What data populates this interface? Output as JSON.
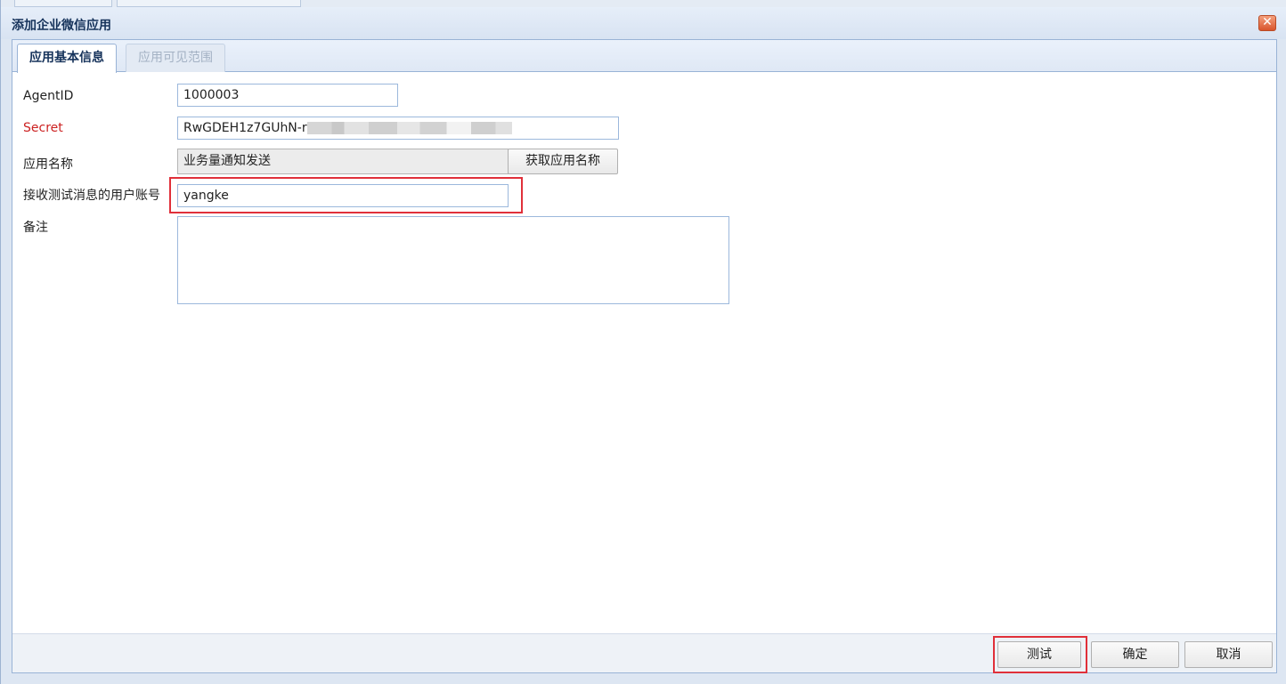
{
  "window": {
    "title": "添加企业微信应用",
    "close_glyph": "✕"
  },
  "tabs": [
    {
      "label": "应用基本信息",
      "active": true
    },
    {
      "label": "应用可见范围",
      "active": false
    }
  ],
  "form": {
    "agentid": {
      "label": "AgentID",
      "value": "1000003"
    },
    "secret": {
      "label": "Secret",
      "value_visible": "RwGDEH1z7GUhN-r",
      "label_color": "#cc2222"
    },
    "app_name": {
      "label": "应用名称",
      "value": "业务量通知发送",
      "button": "获取应用名称"
    },
    "test_user": {
      "label": "接收测试消息的用户账号",
      "value": "yangke"
    },
    "remark": {
      "label": "备注",
      "value": ""
    }
  },
  "footer": {
    "test_button": "测试",
    "ok_button": "确定",
    "cancel_button": "取消"
  },
  "colors": {
    "accent_border": "#99b3d6",
    "highlight": "#e0303a"
  }
}
